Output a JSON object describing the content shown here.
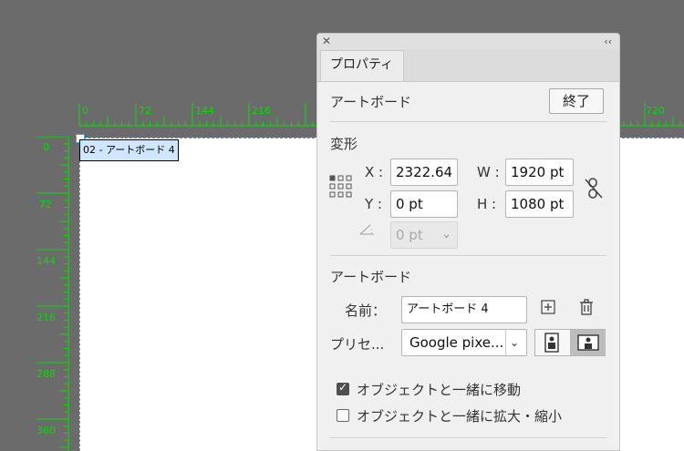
{
  "ruler": {
    "color": "#00e000",
    "h_ticks": [
      "0",
      "72",
      "144",
      "216",
      "720"
    ],
    "v_ticks": [
      "0",
      "72",
      "144",
      "216",
      "288",
      "360"
    ]
  },
  "artboard": {
    "label": "02 - アートボード 4"
  },
  "panel": {
    "tab_label": "プロパティ",
    "artboard_header": "アートボード",
    "done_button": "終了",
    "transform": {
      "title": "変形",
      "x_label": "X :",
      "x_value": "2322.64",
      "y_label": "Y :",
      "y_value": "0 pt",
      "w_label": "W :",
      "w_value": "1920 pt",
      "h_label": "H :",
      "h_value": "1080 pt",
      "rotate_value": "0 pt"
    },
    "artboard_section": {
      "title": "アートボード",
      "name_label": "名前：",
      "name_value": "アートボード 4",
      "preset_label": "プリセ...",
      "preset_value": "Google pixe...",
      "move_with_art": {
        "label": "オブジェクトと一緒に移動",
        "checked": true
      },
      "scale_with_art": {
        "label": "オブジェクトと一緒に拡大・縮小",
        "checked": false
      }
    }
  }
}
